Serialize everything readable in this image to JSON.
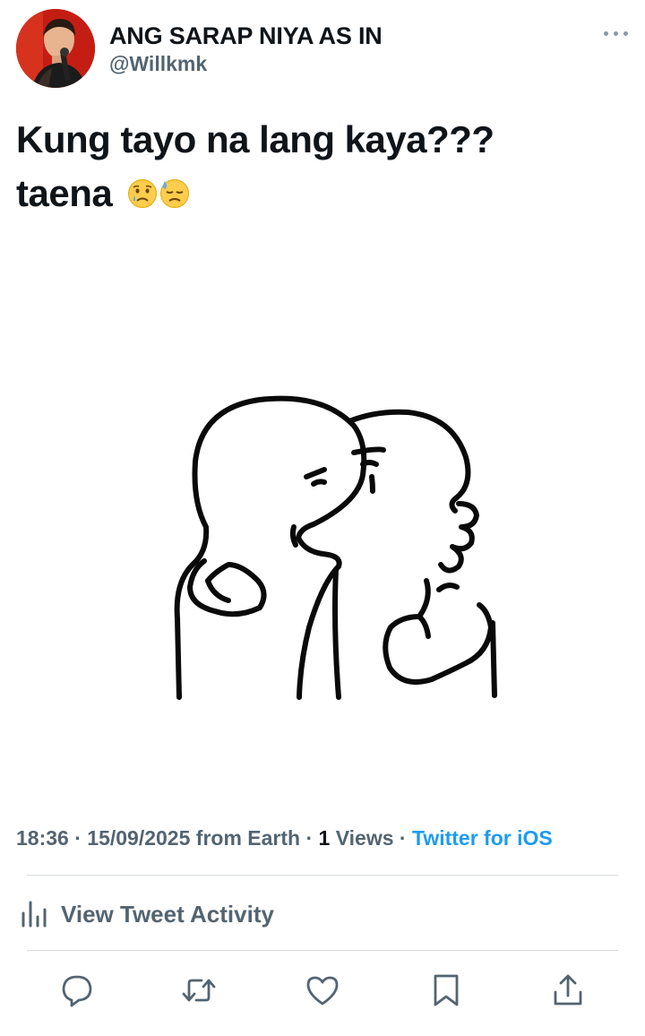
{
  "tweet": {
    "display_name": "ANG SARAP NIYA AS IN",
    "handle": "@Willkmk",
    "text_line1": "Kung tayo na lang kaya???",
    "text_line2": "taena",
    "emojis": [
      "sad-but-relieved-face",
      "downcast-face-with-sweat"
    ]
  },
  "meta": {
    "time": "18:36",
    "sep1": " · ",
    "date": "15/09/2025",
    "location": " from Earth",
    "sep2": " · ",
    "views_count": "1",
    "views_label": " Views",
    "sep3": " · ",
    "source": "Twitter for iOS"
  },
  "activity": {
    "label": "View Tweet Activity"
  },
  "icons": {
    "more": "more-dots-icon",
    "activity": "bar-chart-icon",
    "reply": "reply-icon",
    "retweet": "retweet-icon",
    "like": "heart-icon",
    "bookmark": "bookmark-icon",
    "share": "share-icon"
  },
  "colors": {
    "accent": "#1d9bf0",
    "secondary_text": "#536471",
    "primary_text": "#0f1419",
    "divider": "#d7dbdf"
  }
}
